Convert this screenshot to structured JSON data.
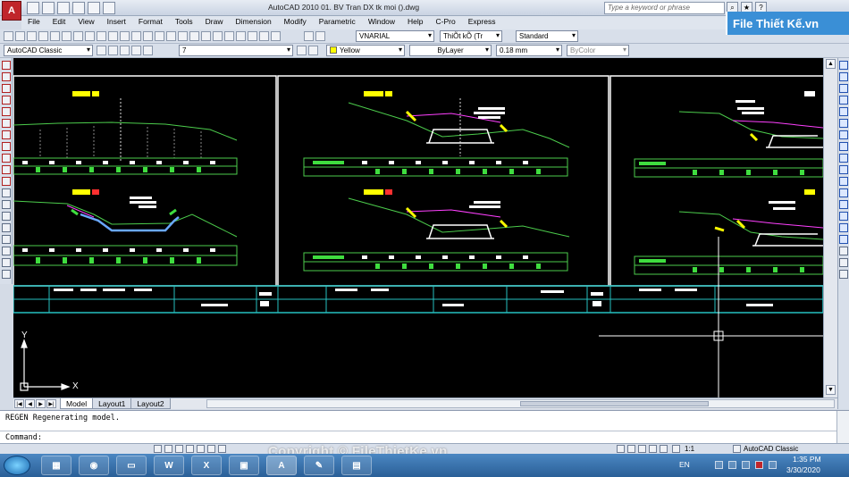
{
  "title_bar": {
    "app_logo": "A",
    "window_title": "AutoCAD 2010    01. BV Tran DX tk moi ().dwg",
    "search_placeholder": "Type a keyword or phrase",
    "brand": "File Thiết Kế.vn"
  },
  "menu": [
    "File",
    "Edit",
    "View",
    "Insert",
    "Format",
    "Tools",
    "Draw",
    "Dimension",
    "Modify",
    "Parametric",
    "Window",
    "Help",
    "C-Pro",
    "Express"
  ],
  "toolbar": {
    "text_style": "VNARIAL",
    "dim_style": "ThiÕt kÕ (Tr",
    "table_style": "Standard",
    "workspace": "AutoCAD Classic",
    "layer": "7",
    "color": "Yellow",
    "linetype": "ByLayer",
    "lineweight": "0.18 mm",
    "plotstyle": "ByColor",
    "color_hex": "#ffff00"
  },
  "ucs": {
    "x_label": "X",
    "y_label": "Y"
  },
  "tabs": [
    "Model",
    "Layout1",
    "Layout2"
  ],
  "command_line": {
    "history": "REGEN Regenerating model.",
    "prompt": "Command:"
  },
  "status_bar": {
    "scale": "1:1",
    "workspace": "AutoCAD Classic"
  },
  "watermark": "Copyright © FileThietKe.vn",
  "taskbar": {
    "language": "EN",
    "time": "1:35 PM",
    "date": "3/30/2020"
  }
}
